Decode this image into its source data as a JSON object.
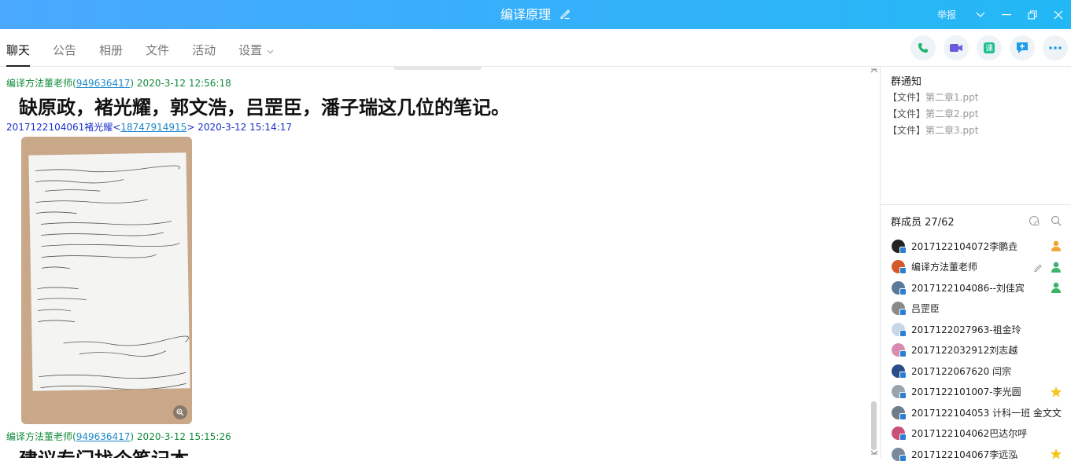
{
  "window": {
    "title": "编译原理",
    "report_label": "举报"
  },
  "tabs": [
    {
      "label": "聊天",
      "active": true
    },
    {
      "label": "公告"
    },
    {
      "label": "相册"
    },
    {
      "label": "文件"
    },
    {
      "label": "活动"
    },
    {
      "label": "设置"
    }
  ],
  "actions": [
    "phone-icon",
    "video-icon",
    "class-icon",
    "add-chat-icon",
    "more-icon"
  ],
  "colors": {
    "titlebar_start": "#4aa8ff",
    "titlebar_end": "#22b8f5",
    "sender_green": "#108a3a",
    "sender_blue": "#1a30c8"
  },
  "messages": [
    {
      "sender": "编译方法董老师",
      "qq": "949636417",
      "time": "2020-3-12 12:56:18",
      "text": "缺原政，褚光耀，郭文浩，吕罡臣，潘子瑞这几位的笔记。"
    },
    {
      "sender": "2017122104061褚光耀",
      "qq": "18747914915",
      "time": "2020-3-12 15:14:17",
      "image": "handwritten-notes-photo"
    },
    {
      "sender": "编译方法董老师",
      "qq": "949636417",
      "time": "2020-3-12 15:15:26",
      "text": "建议专门找个笔记本"
    }
  ],
  "notice": {
    "title": "群通知",
    "items": [
      {
        "tag": "【文件】",
        "name": "第二章1.ppt"
      },
      {
        "tag": "【文件】",
        "name": "第二章2.ppt"
      },
      {
        "tag": "【文件】",
        "name": "第二章3.ppt"
      }
    ]
  },
  "members": {
    "title": "群成员",
    "count": "27/62",
    "list": [
      {
        "name": "2017122104072李鹏垚",
        "badge": "admin"
      },
      {
        "name": "编译方法董老师",
        "badge": "owner"
      },
      {
        "name": "2017122104086--刘佳宾",
        "badge": "admin"
      },
      {
        "name": "吕罡臣"
      },
      {
        "name": "2017122027963-祖金玲"
      },
      {
        "name": "2017122032912刘志越"
      },
      {
        "name": "2017122067620 闫宗"
      },
      {
        "name": "2017122101007-李光圆",
        "badge": "star"
      },
      {
        "name": "2017122104053 计科一班 金文文"
      },
      {
        "name": "2017122104062巴达尔呼"
      },
      {
        "name": "2017122104067李远泓",
        "badge": "star"
      }
    ]
  }
}
